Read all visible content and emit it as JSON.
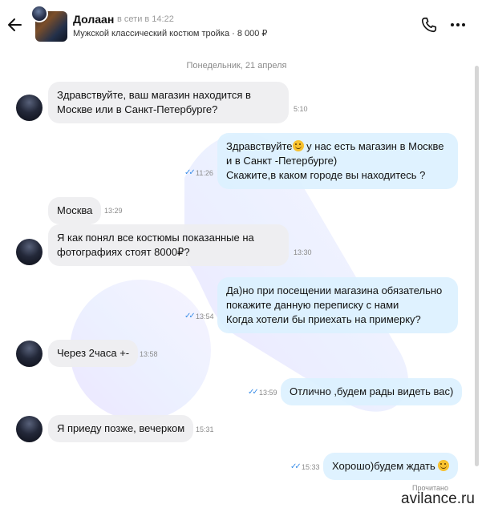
{
  "header": {
    "seller_name": "Долаан",
    "seller_status": "в сети в 14:22",
    "item_subtitle": "Мужской классический костюм тройка · 8 000 ₽"
  },
  "chat": {
    "date_separator": "Понедельник, 21 апреля",
    "read_label": "Прочитано",
    "messages": [
      {
        "direction": "in",
        "lines": [
          "Здравствуйте, ваш магазин находится в",
          "Москве или в Санкт-Петербурге?"
        ],
        "time": "5:10"
      },
      {
        "direction": "out",
        "lines": [
          "Здравствуйте",
          " у нас есть магазин в Москве",
          "и в Санкт -Петербурге)",
          "Скажите,в каком городе вы находитесь ?"
        ],
        "time": "11:26"
      },
      {
        "direction": "in",
        "lines": [
          "Москва"
        ],
        "time": "13:29"
      },
      {
        "direction": "in",
        "lines": [
          "Я как понял все костюмы показанные на",
          "фотографиях стоят 8000₽?"
        ],
        "time": "13:30"
      },
      {
        "direction": "out",
        "lines": [
          "Да)но при посещении магазина обязательно",
          "покажите данную переписку с нами",
          "Когда хотели бы приехать на примерку?"
        ],
        "time": "13:54"
      },
      {
        "direction": "in",
        "lines": [
          "Через 2часа +-"
        ],
        "time": "13:58"
      },
      {
        "direction": "out",
        "lines": [
          "Отлично ,будем рады видеть вас)"
        ],
        "time": "13:59"
      },
      {
        "direction": "in",
        "lines": [
          "Я приеду позже, вечерком"
        ],
        "time": "15:31"
      },
      {
        "direction": "out",
        "lines": [
          "Хорошо)будем ждать "
        ],
        "time": "15:33"
      }
    ]
  },
  "watermark": {
    "site": "avilance.ru"
  },
  "colors": {
    "accent": "#3b8ee8",
    "bubble_in": "#eeeeF0",
    "bubble_out": "#dcf1ff"
  }
}
